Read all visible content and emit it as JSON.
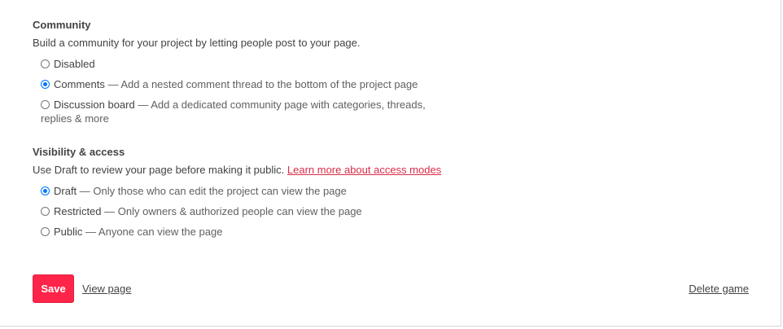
{
  "community": {
    "title": "Community",
    "description": "Build a community for your project by letting people post to your page.",
    "options": [
      {
        "label": "Disabled",
        "detail": "",
        "checked": false
      },
      {
        "label": "Comments",
        "detail": " — Add a nested comment thread to the bottom of the project page",
        "checked": true
      },
      {
        "label": "Discussion board",
        "detail": " — Add a dedicated community page with categories, threads,",
        "detail2": "replies & more",
        "checked": false
      }
    ]
  },
  "visibility": {
    "title": "Visibility & access",
    "description": "Use Draft to review your page before making it public. ",
    "learn_more": "Learn more about access modes",
    "options": [
      {
        "label": "Draft",
        "detail": " — Only those who can edit the project can view the page",
        "checked": true
      },
      {
        "label": "Restricted",
        "detail": " — Only owners & authorized people can view the page",
        "checked": false
      },
      {
        "label": "Public",
        "detail": " — Anyone can view the page",
        "checked": false
      }
    ]
  },
  "footer": {
    "save_label": "Save",
    "view_page_label": "View page",
    "delete_game_label": "Delete game"
  },
  "colors": {
    "accent": "#ff2449",
    "link": "#da2c49",
    "radio_checked": "#0075ff"
  }
}
